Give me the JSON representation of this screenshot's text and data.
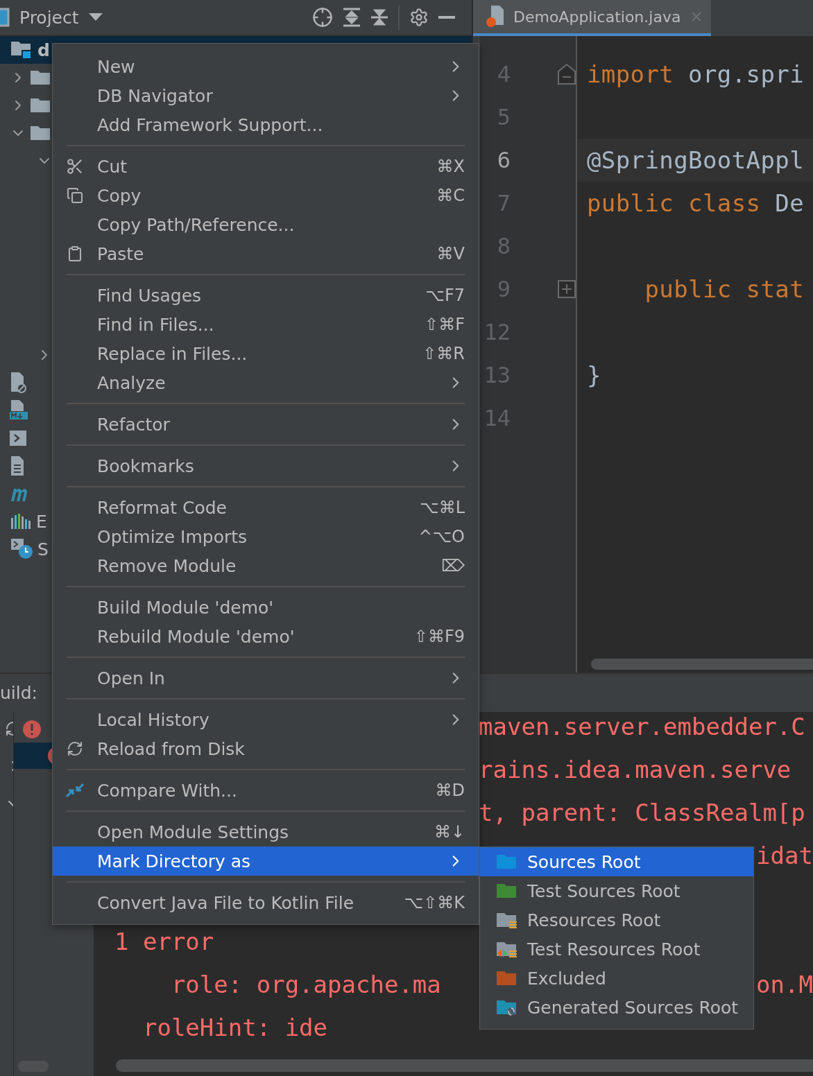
{
  "project_panel": {
    "title": "Project",
    "tree": [
      {
        "label": "d",
        "selected": true,
        "children": [
          {
            "kind": "folder",
            "expanded": false
          },
          {
            "kind": "folder",
            "expanded": false
          },
          {
            "kind": "folder",
            "expanded": true,
            "children": [
              {
                "kind": "folder",
                "expanded": true
              },
              {
                "kind": "folder",
                "expanded": false
              }
            ]
          },
          {
            "kind": "ignored"
          },
          {
            "kind": "markdown"
          },
          {
            "kind": "script"
          },
          {
            "kind": "text"
          },
          {
            "kind": "maven"
          }
        ]
      },
      {
        "label": "E",
        "kind": "libraries"
      },
      {
        "label": "S",
        "kind": "scratches"
      }
    ]
  },
  "editor": {
    "tab": {
      "label": "DemoApplication.java",
      "selected": true
    },
    "lines": [
      {
        "number": "4",
        "current": false,
        "folded": false,
        "tokens": [
          {
            "text": "import",
            "kind": "keyword"
          },
          {
            "text": " org.spri",
            "kind": "plain"
          }
        ]
      },
      {
        "number": "5",
        "current": false
      },
      {
        "number": "6",
        "current": true,
        "tokens": [
          {
            "text": "@SpringBootAppl",
            "kind": "plain"
          }
        ]
      },
      {
        "number": "7",
        "current": false,
        "tokens": [
          {
            "text": "public class",
            "kind": "keyword"
          },
          {
            "text": " De",
            "kind": "plain"
          }
        ]
      },
      {
        "number": "8",
        "current": false
      },
      {
        "number": "9",
        "current": false,
        "folded": true,
        "tokens": [
          {
            "text": "    public stat",
            "kind": "keyword"
          }
        ]
      },
      {
        "number": "12",
        "current": false
      },
      {
        "number": "13",
        "current": false,
        "tokens": [
          {
            "text": "}",
            "kind": "plain"
          }
        ]
      },
      {
        "number": "14",
        "current": false
      }
    ]
  },
  "build_panel": {
    "title": "uild:",
    "tree": [
      {
        "kind": "error",
        "selected": false
      },
      {
        "kind": "error",
        "selected": true
      }
    ],
    "console": [
      {
        "right": "maven.server.embedder.C"
      },
      {
        "right": "rains.idea.maven.serve"
      },
      {
        "right": "t, parent: ClassRealm[p"
      },
      {
        "right": "idat",
        "clipped": true
      },
      {
        "left": "1 error",
        "gap_before": true
      },
      {
        "left": "    role: org.apache.ma",
        "right": "on.M",
        "clipped": true
      },
      {
        "left": "  roleHint: ide"
      }
    ]
  },
  "context_menu": {
    "groups": [
      [
        {
          "label": "New",
          "submenu": true,
          "selected": false
        },
        {
          "label": "DB Navigator",
          "submenu": true,
          "selected": false
        },
        {
          "label": "Add Framework Support...",
          "selected": false
        }
      ],
      [
        {
          "label": "Cut",
          "shortcut": "⌘X",
          "selected": false
        },
        {
          "label": "Copy",
          "shortcut": "⌘C",
          "selected": false
        },
        {
          "label": "Copy Path/Reference...",
          "selected": false
        },
        {
          "label": "Paste",
          "shortcut": "⌘V",
          "selected": false
        }
      ],
      [
        {
          "label": "Find Usages",
          "shortcut": "⌥F7",
          "selected": false
        },
        {
          "label": "Find in Files...",
          "shortcut": "⇧⌘F",
          "selected": false
        },
        {
          "label": "Replace in Files...",
          "shortcut": "⇧⌘R",
          "selected": false
        },
        {
          "label": "Analyze",
          "submenu": true,
          "selected": false
        }
      ],
      [
        {
          "label": "Refactor",
          "submenu": true,
          "selected": false
        }
      ],
      [
        {
          "label": "Bookmarks",
          "submenu": true,
          "selected": false
        }
      ],
      [
        {
          "label": "Reformat Code",
          "shortcut": "⌥⌘L",
          "selected": false
        },
        {
          "label": "Optimize Imports",
          "shortcut": "^⌥O",
          "selected": false
        },
        {
          "label": "Remove Module",
          "shortcut": "⌦",
          "selected": false
        }
      ],
      [
        {
          "label": "Build Module 'demo'",
          "selected": false
        },
        {
          "label": "Rebuild Module 'demo'",
          "shortcut": "⇧⌘F9",
          "selected": false
        }
      ],
      [
        {
          "label": "Open In",
          "submenu": true,
          "selected": false
        }
      ],
      [
        {
          "label": "Local History",
          "submenu": true,
          "selected": false
        },
        {
          "label": "Reload from Disk",
          "selected": false
        }
      ],
      [
        {
          "label": "Compare With...",
          "shortcut": "⌘D",
          "selected": false
        }
      ],
      [
        {
          "label": "Open Module Settings",
          "shortcut": "⌘↓",
          "selected": false
        },
        {
          "label": "Mark Directory as",
          "submenu": true,
          "selected": true
        }
      ],
      [
        {
          "label": "Convert Java File to Kotlin File",
          "shortcut": "⌥⇧⌘K",
          "selected": false
        }
      ]
    ]
  },
  "submenu": {
    "items": [
      {
        "label": "Sources Root",
        "selected": true,
        "color": "#0f8fd8"
      },
      {
        "label": "Test Sources Root",
        "selected": false,
        "color": "#3d8b37"
      },
      {
        "label": "Resources Root",
        "selected": false,
        "color": "#8c97a1"
      },
      {
        "label": "Test Resources Root",
        "selected": false,
        "color": "#8c97a1"
      },
      {
        "label": "Excluded",
        "selected": false,
        "color": "#b4501f"
      },
      {
        "label": "Generated Sources Root",
        "selected": false,
        "color": "#1f8fb0"
      }
    ]
  }
}
